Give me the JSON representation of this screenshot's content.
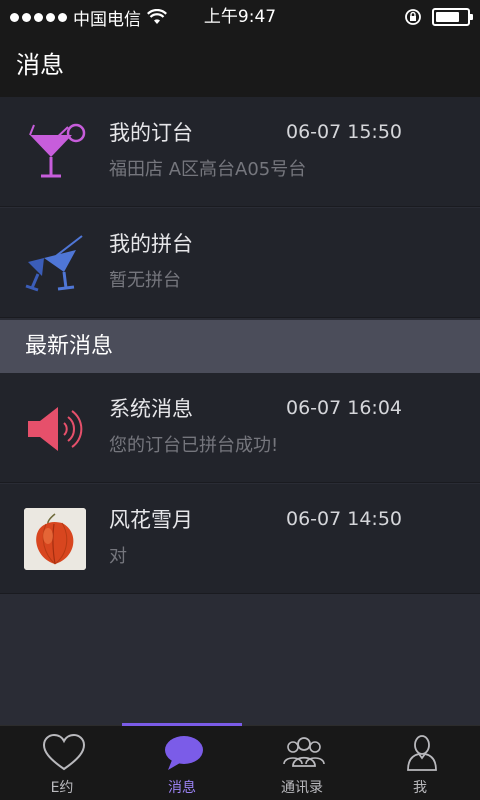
{
  "status_bar": {
    "carrier": "中国电信",
    "time": "上午9:47",
    "signal_bars": 5,
    "battery_level": 0.78
  },
  "header": {
    "title": "消息"
  },
  "rows": [
    {
      "title": "我的订台",
      "time": "06-07 15:50",
      "subtitle": "福田店 A区高台A05号台",
      "icon": "cocktail-glass-icon",
      "icon_color": "#c75ddb"
    },
    {
      "title": "我的拼台",
      "time": "",
      "subtitle": "暂无拼台",
      "icon": "toast-glasses-icon",
      "icon_color": "#4f76d6"
    }
  ],
  "section": {
    "title": "最新消息"
  },
  "messages": [
    {
      "title": "系统消息",
      "time": "06-07 16:04",
      "subtitle": "您的订台已拼台成功!",
      "icon": "speaker-icon",
      "icon_color": "#e6506b"
    },
    {
      "title": "风花雪月",
      "time": "06-07 14:50",
      "subtitle": "对",
      "icon": "avatar-lantern-flower"
    }
  ],
  "tabs": [
    {
      "label": "E约",
      "icon": "heart-icon",
      "active": false
    },
    {
      "label": "消息",
      "icon": "chat-bubble-icon",
      "active": true
    },
    {
      "label": "通讯录",
      "icon": "contacts-icon",
      "active": false
    },
    {
      "label": "我",
      "icon": "person-icon",
      "active": false
    }
  ],
  "colors": {
    "accent": "#7b5ce8",
    "background": "#2a2c35",
    "row": "#22242b",
    "section": "#4b4d5a"
  }
}
